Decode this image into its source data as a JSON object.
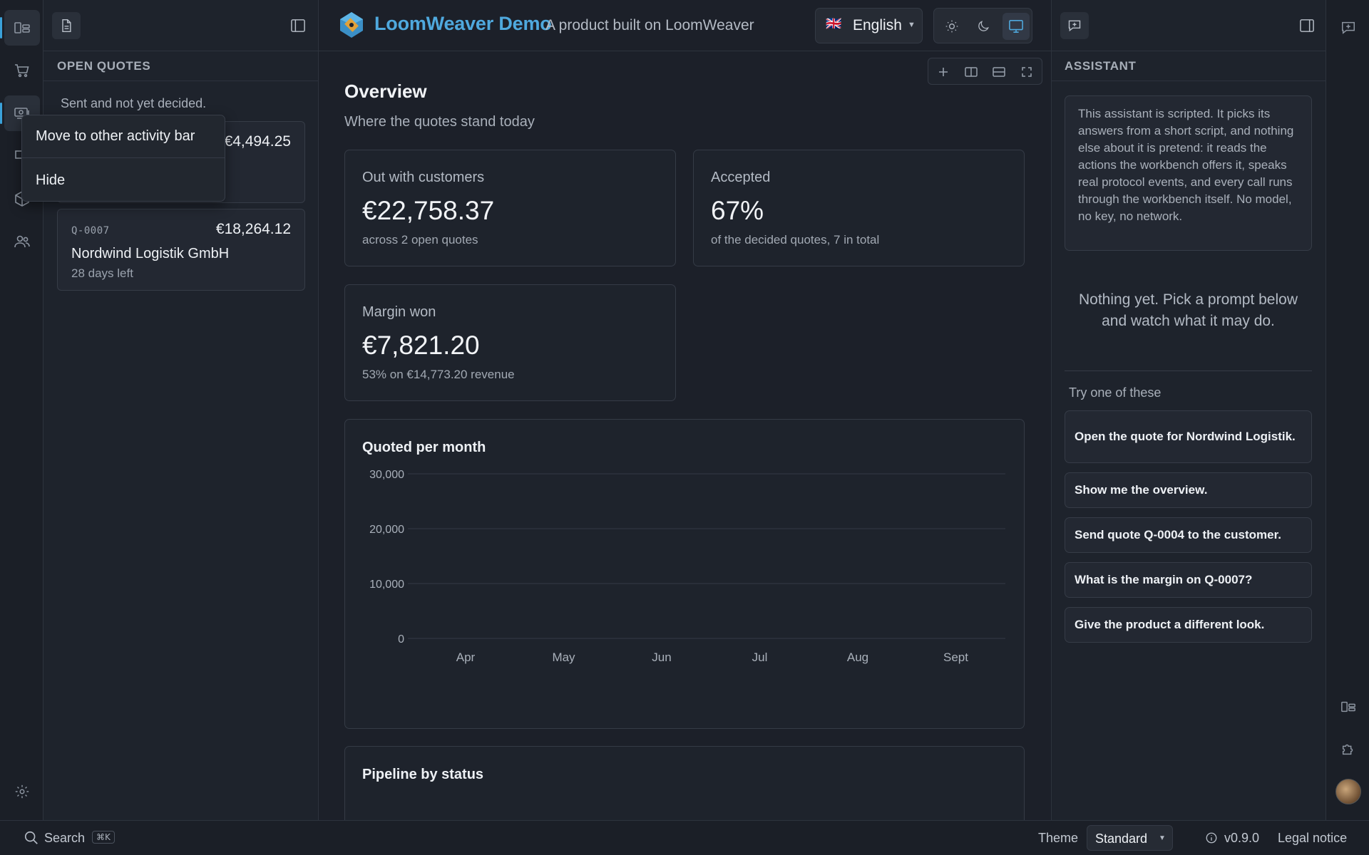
{
  "header": {
    "brand": "LoomWeaver Demo",
    "tagline": "A product built on LoomWeaver",
    "language": "English",
    "language_flag": "🇬🇧"
  },
  "sidebar": {
    "section_title": "OPEN QUOTES",
    "subtitle": "Sent and not yet decided.",
    "quotes": [
      {
        "amount": "€4,494.25"
      },
      {
        "id": "Q-0007",
        "amount": "€18,264.12",
        "customer": "Nordwind Logistik GmbH",
        "days_left": "28 days left"
      }
    ]
  },
  "context_menu": {
    "items": [
      "Move to other activity bar",
      "Hide"
    ]
  },
  "main": {
    "title": "Overview",
    "subtitle": "Where the quotes stand today",
    "kpis": [
      {
        "label": "Out with customers",
        "value": "€22,758.37",
        "sub": "across 2 open quotes"
      },
      {
        "label": "Accepted",
        "value": "67%",
        "sub": "of the decided quotes, 7 in total"
      },
      {
        "label": "Margin won",
        "value": "€7,821.20",
        "sub": "53% on €14,773.20 revenue"
      }
    ],
    "pipeline_title": "Pipeline by status"
  },
  "chart_data": {
    "type": "bar",
    "title": "Quoted per month",
    "categories": [
      "Apr",
      "May",
      "Jun",
      "Jul",
      "Aug",
      "Sept"
    ],
    "values": [
      0,
      0,
      0,
      0,
      0,
      0
    ],
    "yticks": [
      "30,000",
      "20,000",
      "10,000",
      "0"
    ],
    "ylim": [
      0,
      30000
    ],
    "grid": true
  },
  "assistant": {
    "title": "ASSISTANT",
    "info": "This assistant is scripted. It picks its answers from a short script, and nothing else about it is pretend: it reads the actions the workbench offers it, speaks real protocol events, and every call runs through the workbench itself. No model, no key, no network.",
    "empty_message": "Nothing yet. Pick a prompt below and watch what it may do.",
    "try_label": "Try one of these",
    "prompts": [
      "Open the quote for Nordwind Logistik.",
      "Show me the overview.",
      "Send quote Q-0004 to the customer.",
      "What is the margin on Q-0007?",
      "Give the product a different look."
    ]
  },
  "statusbar": {
    "search_label": "Search",
    "search_shortcut": "⌘K",
    "theme_label": "Theme",
    "theme_value": "Standard",
    "version": "v0.9.0",
    "legal": "Legal notice"
  },
  "colors": {
    "accent": "#4fa9de",
    "background": "#1c2029",
    "panel": "#1e232c",
    "border": "#353b46"
  }
}
